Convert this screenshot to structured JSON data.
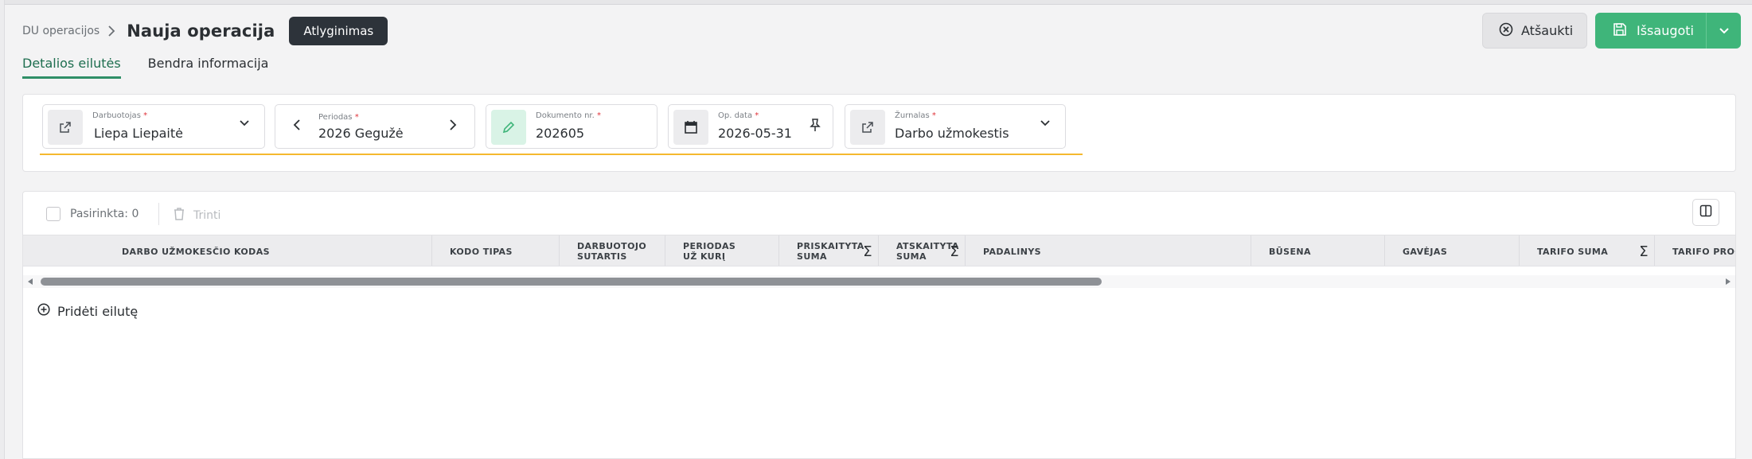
{
  "header": {
    "breadcrumb": "DU operacijos",
    "title": "Nauja operacija",
    "badge": "Atlyginimas",
    "cancel_label": "Atšaukti",
    "save_label": "Išsaugoti"
  },
  "tabs": [
    {
      "label": "Detalios eilutės",
      "active": true
    },
    {
      "label": "Bendra informacija",
      "active": false
    }
  ],
  "filters": {
    "employee": {
      "label": "Darbuotojas",
      "required_mark": "*",
      "value": "Liepa Liepaitė"
    },
    "period": {
      "label": "Periodas",
      "required_mark": "*",
      "value": "2026 Gegužė"
    },
    "document": {
      "label": "Dokumento nr.",
      "required_mark": "*",
      "value": "202605"
    },
    "op_date": {
      "label": "Op. data",
      "required_mark": "*",
      "value": "2026-05-31"
    },
    "journal": {
      "label": "Žurnalas",
      "required_mark": "*",
      "value": "Darbo užmokestis"
    }
  },
  "grid": {
    "selected_text": "Pasirinkta: 0",
    "delete_label": "Trinti",
    "columns": [
      {
        "label": "DARBO UŽMOKESČIO KODAS",
        "sum": false
      },
      {
        "label": "KODO TIPAS",
        "sum": false
      },
      {
        "label": "DARBUOTOJO SUTARTIS",
        "sum": false
      },
      {
        "label": "PERIODAS UŽ KURĮ",
        "sum": false
      },
      {
        "label": "PRISKAITYTA SUMA",
        "sum": true
      },
      {
        "label": "ATSKAITYTA SUMA",
        "sum": true
      },
      {
        "label": "PADALINYS",
        "sum": false
      },
      {
        "label": "BŪSENA",
        "sum": false
      },
      {
        "label": "GAVĖJAS",
        "sum": false
      },
      {
        "label": "TARIFO SUMA",
        "sum": true
      },
      {
        "label": "TARIFO PROC",
        "sum": false
      }
    ],
    "add_row_label": "Pridėti eilutę"
  },
  "colors": {
    "accent_green": "#3fb57a",
    "tab_active": "#1e6e4f",
    "badge_dark": "#2d333a",
    "highlight_yellow": "#f5b82e"
  }
}
